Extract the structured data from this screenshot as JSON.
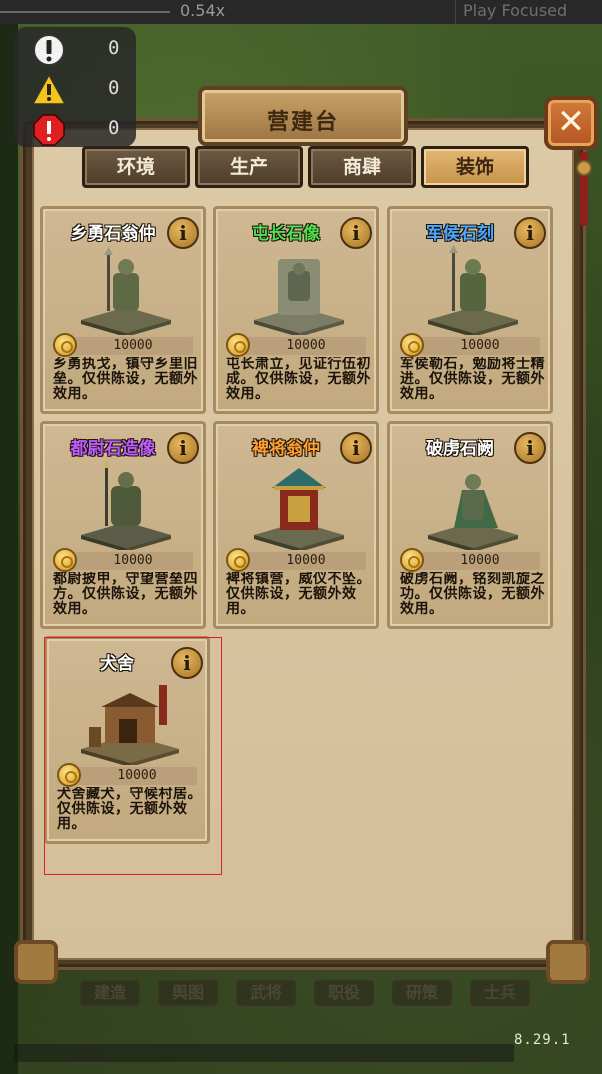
{
  "editor": {
    "zoom_label": "0.54x",
    "play_mode_label": "Play Focused"
  },
  "stats": {
    "info_count": "0",
    "warning_count": "0",
    "error_count": "0"
  },
  "panel": {
    "title": "营建台",
    "close_label": "✕"
  },
  "tabs": [
    {
      "label": "环境",
      "active": false
    },
    {
      "label": "生产",
      "active": false
    },
    {
      "label": "商肆",
      "active": false
    },
    {
      "label": "装饰",
      "active": true
    }
  ],
  "cards": [
    {
      "name": "乡勇石翁仲",
      "name_color": "#ffffff",
      "price": "10000",
      "desc": "乡勇执戈，镇守乡里旧垒。仅供陈设，无额外效用。",
      "info": "i"
    },
    {
      "name": "屯长石像",
      "name_color": "#4fe04f",
      "price": "10000",
      "desc": "屯长肃立，见证行伍初成。仅供陈设，无额外效用。",
      "info": "i"
    },
    {
      "name": "军侯石刻",
      "name_color": "#4aa8ff",
      "price": "10000",
      "desc": "军侯勒石，勉励将士精进。仅供陈设，无额外效用。",
      "info": "i"
    },
    {
      "name": "都尉石造像",
      "name_color": "#c05cff",
      "price": "10000",
      "desc": "都尉披甲，守望营垒四方。仅供陈设，无额外效用。",
      "info": "i"
    },
    {
      "name": "裨将翁仲",
      "name_color": "#ffa032",
      "price": "10000",
      "desc": "裨将镇营，威仪不坠。仅供陈设，无额外效用。",
      "info": "i"
    },
    {
      "name": "破虏石阙",
      "name_color": "#ffffff",
      "price": "10000",
      "desc": "破虏石阙，铭刻凯旋之功。仅供陈设，无额外效用。",
      "info": "i"
    },
    {
      "name": "犬舍",
      "name_color": "#ffffff",
      "price": "10000",
      "desc": "犬舍藏犬，守候村居。仅供陈设，无额外效用。",
      "info": "i"
    }
  ],
  "bottom_nav": [
    "建造",
    "舆图",
    "武将",
    "职役",
    "研策",
    "士兵"
  ],
  "version": "8.29.1"
}
